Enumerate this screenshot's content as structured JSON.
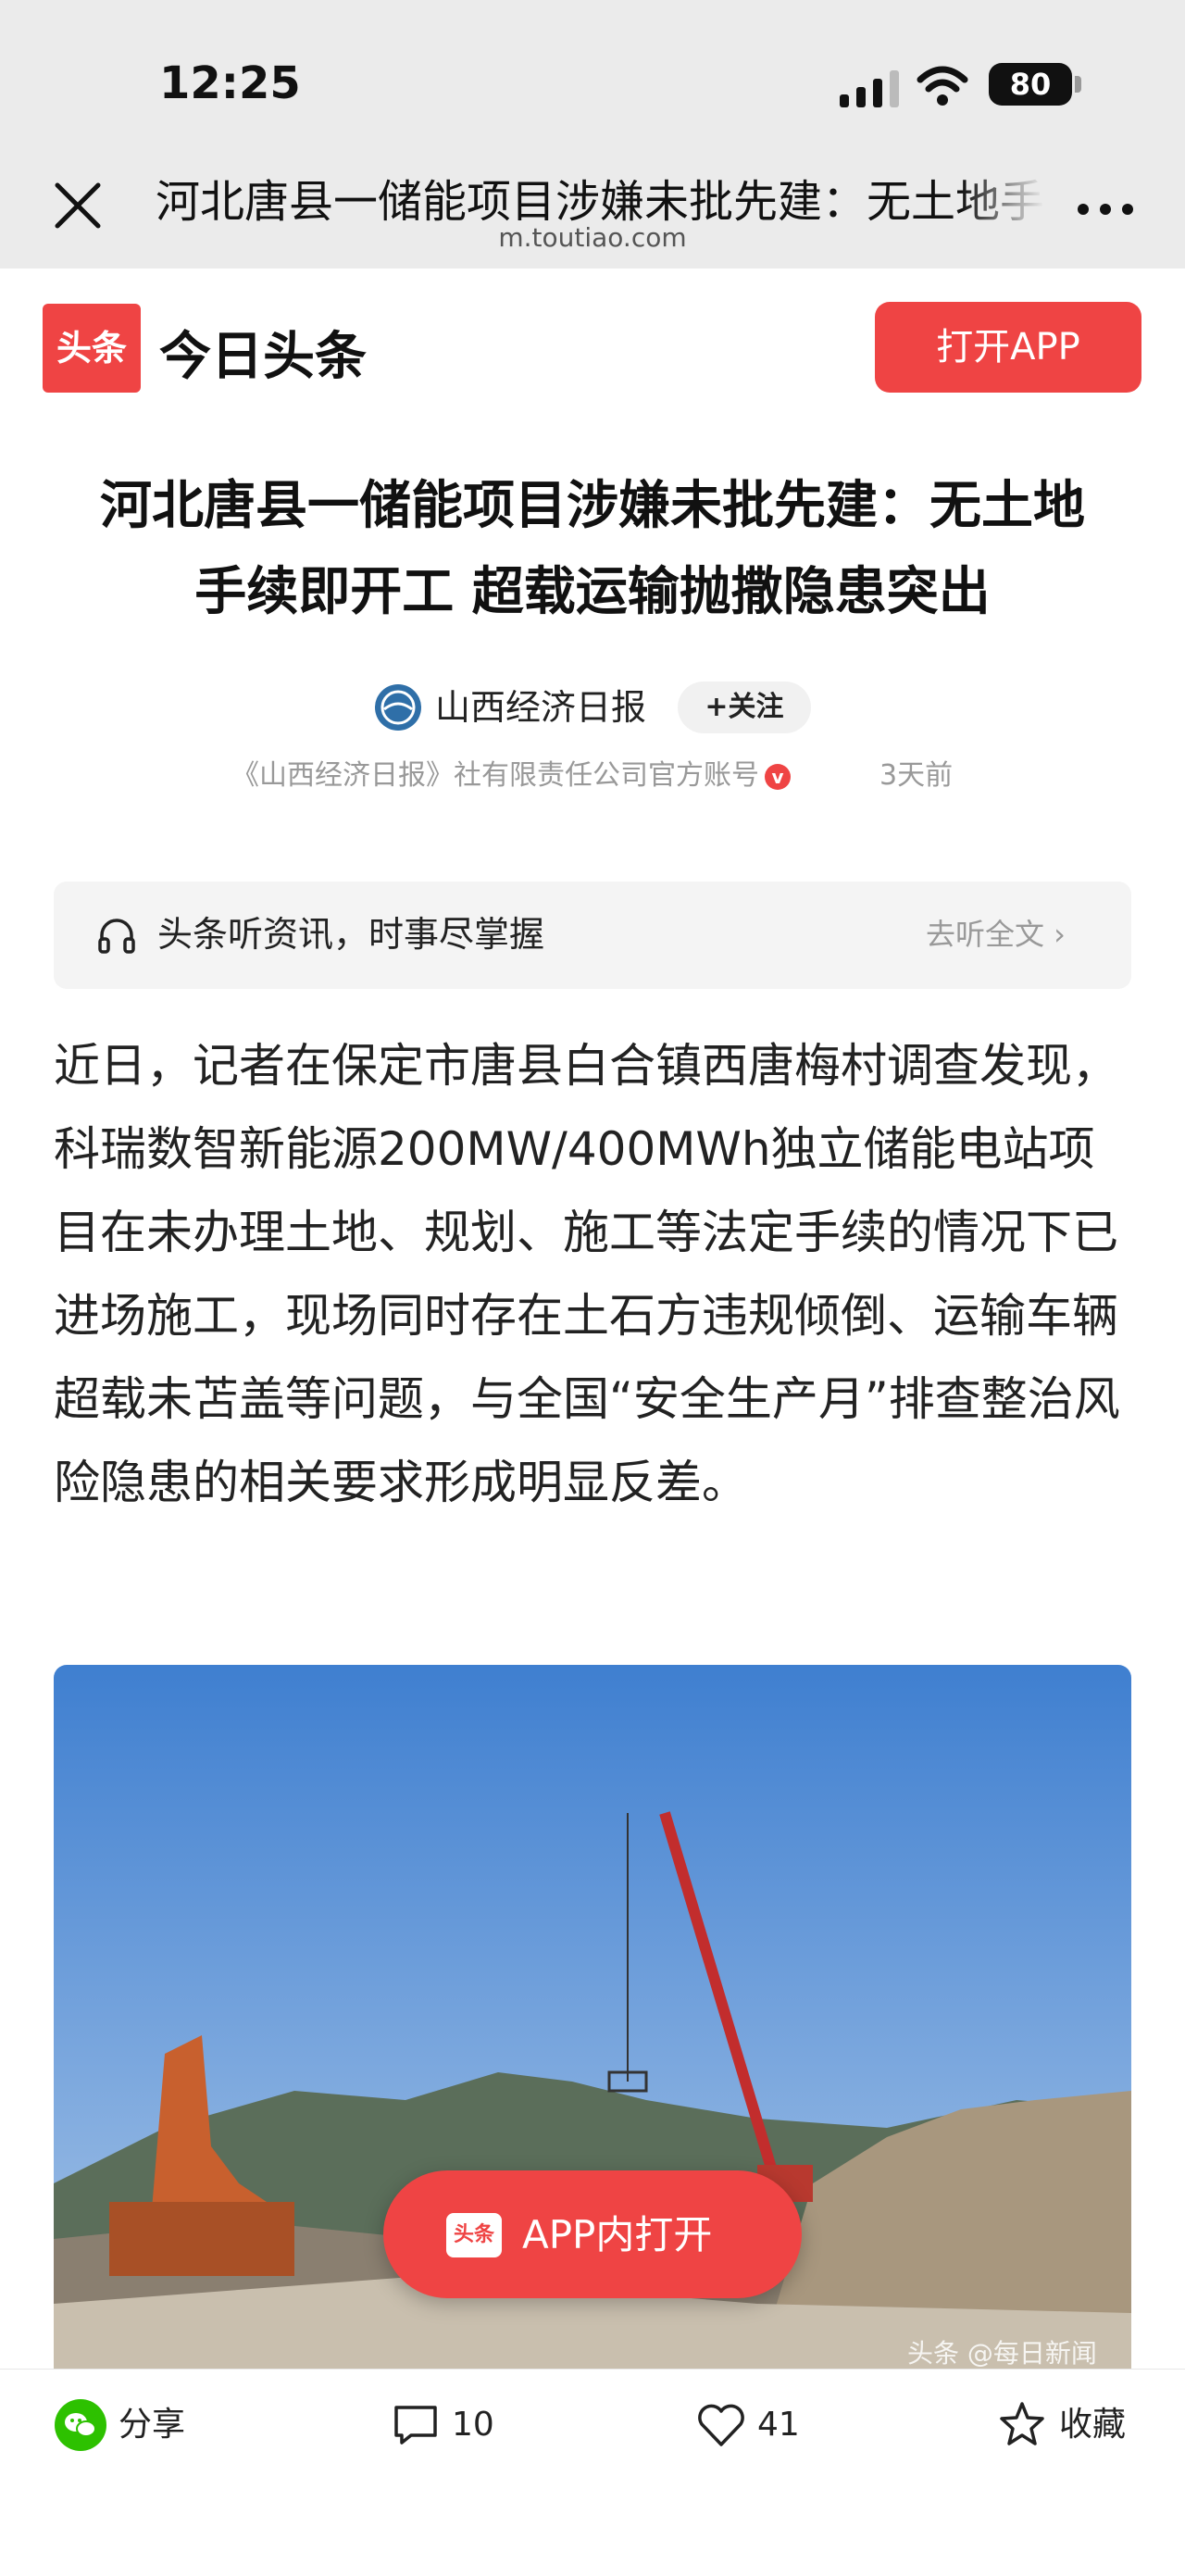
{
  "status_bar": {
    "time": "12:25",
    "battery": "80"
  },
  "browser": {
    "title": "河北唐县一储能项目涉嫌未批先建：无土地手续即开工 超载运输抛撒隐患突出",
    "domain": "m.toutiao.com"
  },
  "app_banner": {
    "logo_text": "头条",
    "app_name": "今日头条",
    "open_button": "打开APP"
  },
  "article": {
    "title_line1": "河北唐县一储能项目涉嫌未批先建：无土地",
    "title_line2": "手续即开工 超载运输抛撒隐患突出",
    "author_name": "山西经济日报",
    "follow_label": "+关注",
    "author_desc": "《山西经济日报》社有限责任公司官方账号",
    "verified_mark": "v",
    "post_time": "3天前",
    "listen_text": "头条听资讯，时事尽掌握",
    "listen_link": "去听全文 ›",
    "body": "近日，记者在保定市唐县白合镇西唐梅村调查发现，科瑞数智新能源200MW/400MWh独立储能电站项目在未办理土地、规划、施工等法定手续的情况下已进场施工，现场同时存在土石方违规倾倒、运输车辆超载未苫盖等问题，与全国“安全生产月”排查整治风险隐患的相关要求形成明显反差。",
    "image_watermark": "头条 @每日新闻"
  },
  "float_button": {
    "logo_text": "头条",
    "label": "APP内打开"
  },
  "bottom_bar": {
    "share_label": "分享",
    "comment_count": "10",
    "like_count": "41",
    "favorite_label": "收藏"
  },
  "colors": {
    "accent": "#ef4444",
    "header_bg": "#ebebeb",
    "wechat_green": "#2dc100"
  }
}
